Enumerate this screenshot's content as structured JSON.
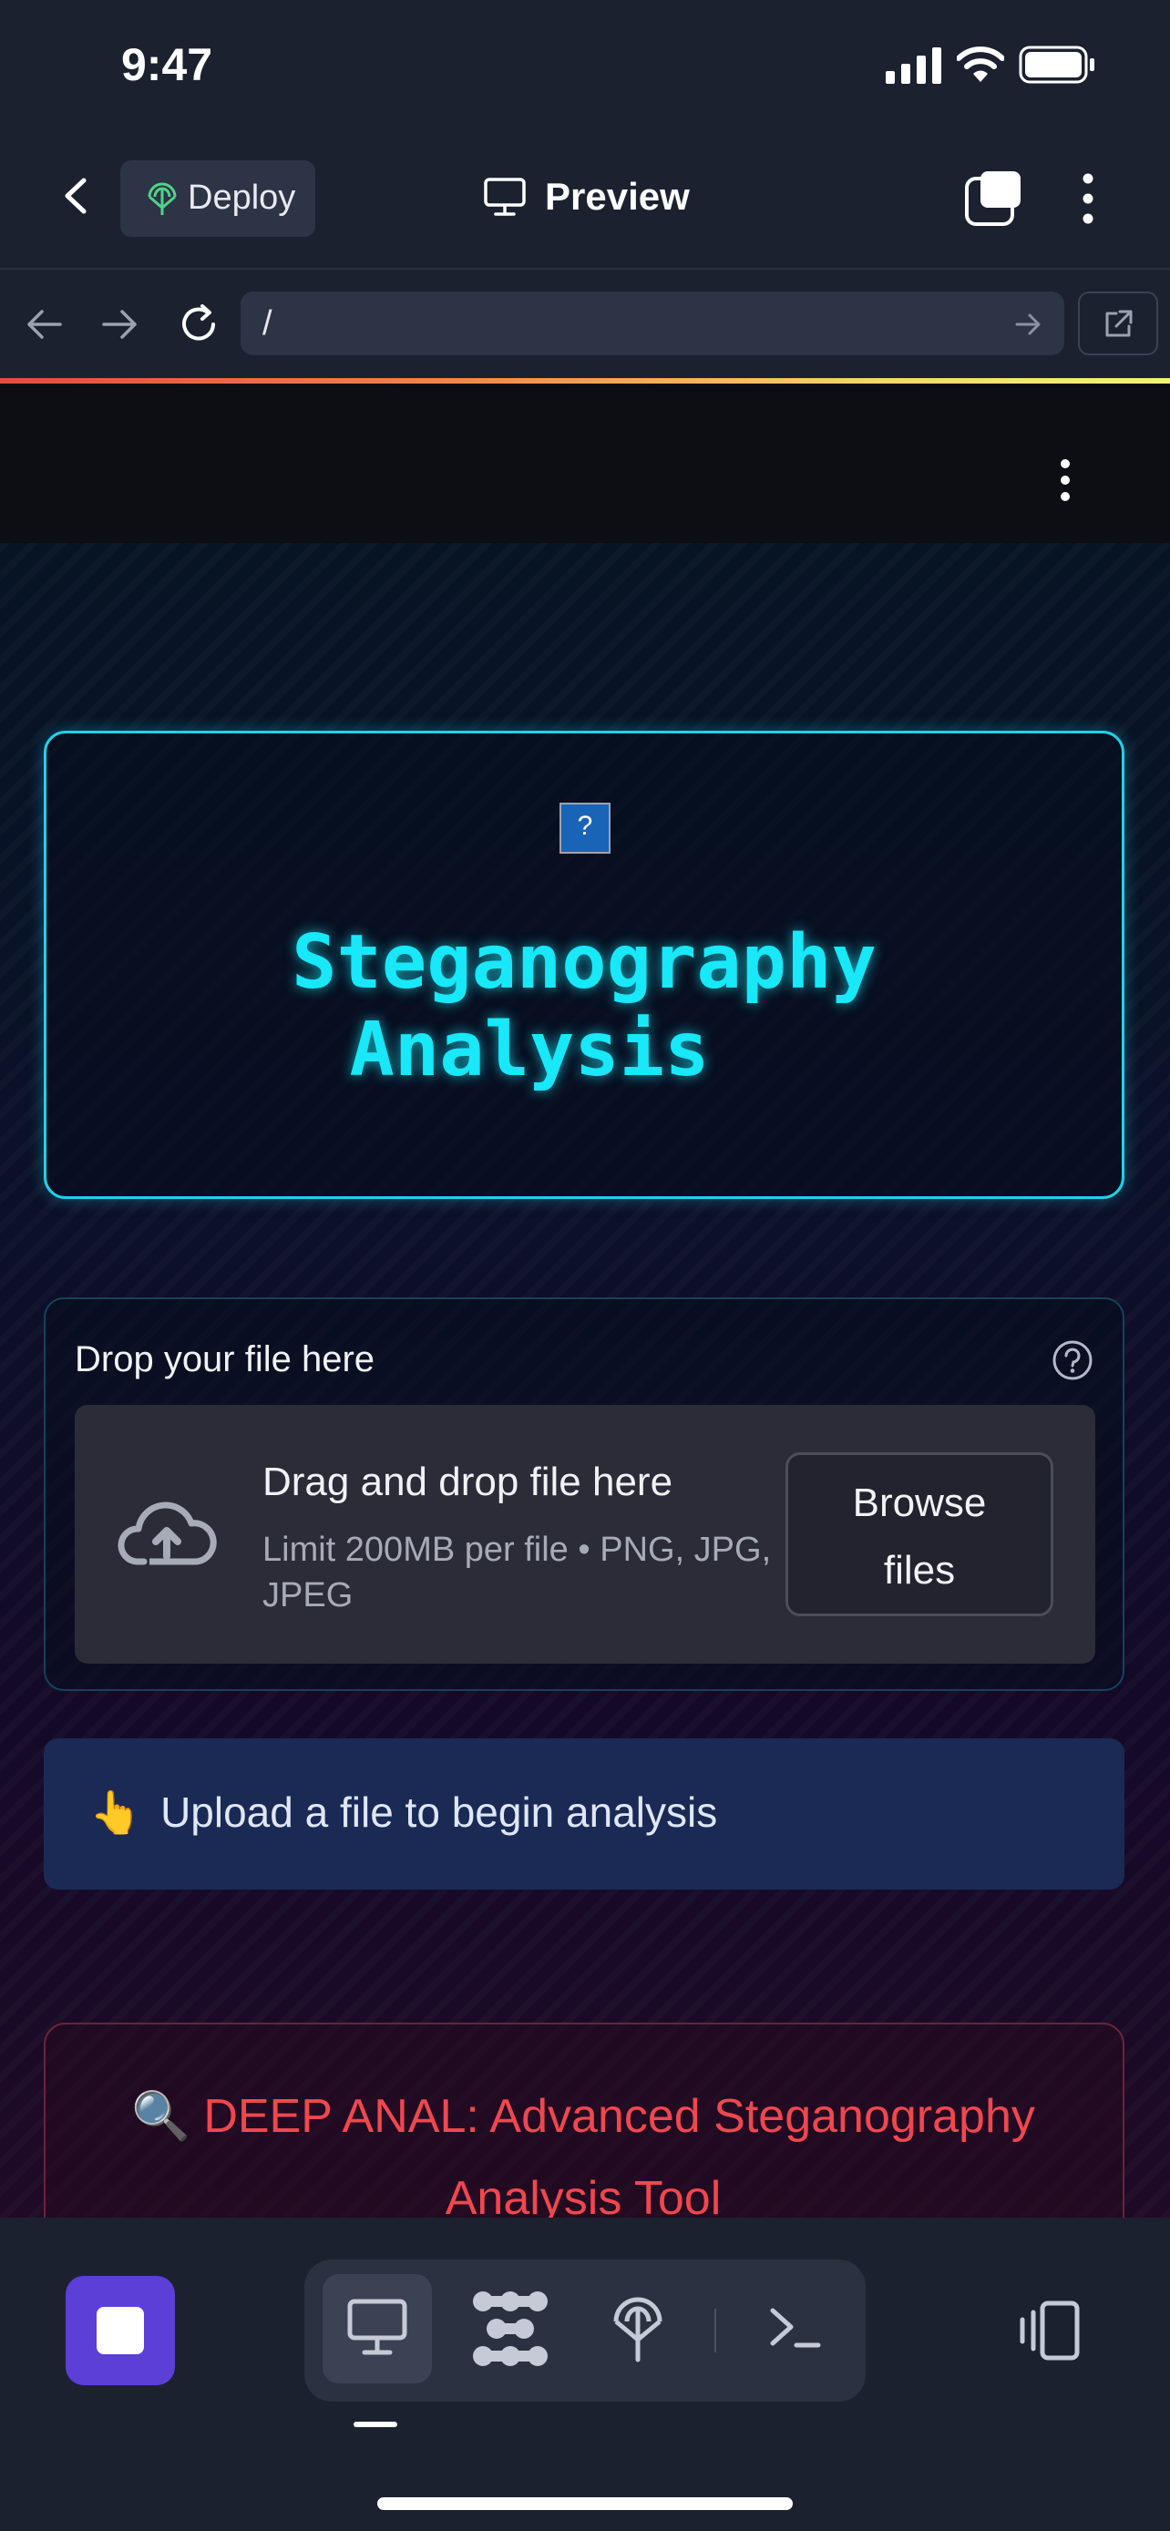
{
  "status_bar": {
    "time": "9:47"
  },
  "top_bar": {
    "deploy_label": "Deploy",
    "preview_label": "Preview"
  },
  "browser": {
    "url": "/"
  },
  "hero": {
    "icon_text": "?",
    "title_line1": "Steganography",
    "title_line2": "Analysis",
    "title_color": "#18e8f8"
  },
  "uploader": {
    "label": "Drop your file here",
    "dropzone_title": "Drag and drop file here",
    "dropzone_subtitle": "Limit 200MB per file • PNG, JPG, JPEG",
    "browse_line1": "Browse",
    "browse_line2": "files"
  },
  "info": {
    "emoji": "👆",
    "text": "Upload a file to begin analysis"
  },
  "tool": {
    "emoji": "🔍",
    "title": "DEEP ANAL: Advanced Steganography Analysis Tool",
    "title_color": "#f0474f"
  },
  "colors": {
    "accent": "#5b3fd6",
    "cyan": "#1fd2e8",
    "info_bg": "#1b2a55"
  }
}
